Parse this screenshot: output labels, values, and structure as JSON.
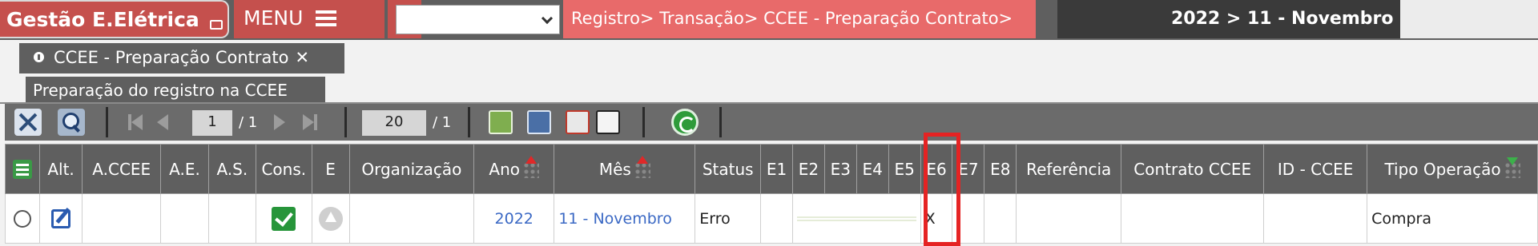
{
  "header": {
    "app_title": "Gestão E.Elétrica",
    "menu_label": "MENU",
    "select_value": "",
    "breadcrumb": "Registro> Transação> CCEE - Preparação Contrato>",
    "period": "2022 > 11 - Novembro"
  },
  "tabs": {
    "main_label": "CCEE - Preparação Contrato",
    "close_glyph": "✕",
    "sub_label": "Preparação do registro na CCEE"
  },
  "toolbar": {
    "page_current": "1",
    "page_total": "/ 1",
    "page_size": "20",
    "page_size_total": "/ 1"
  },
  "table": {
    "columns": [
      "Alt.",
      "A.CCEE",
      "A.E.",
      "A.S.",
      "Cons.",
      "E",
      "Organização",
      "Ano",
      "Mês",
      "Status",
      "E1",
      "E2",
      "E3",
      "E4",
      "E5",
      "E6",
      "E7",
      "E8",
      "Referência",
      "Contrato CCEE",
      "ID - CCEE",
      "Tipo Operação"
    ],
    "row": {
      "ano": "2022",
      "mes": "11 - Novembro",
      "status": "Erro",
      "e6": "X",
      "tipo_operacao": "Compra"
    }
  },
  "colors": {
    "brand_red": "#c5504d",
    "breadcrumb_red": "#e86a6a",
    "bar_gray": "#5f5f5f",
    "link_blue": "#3a68c4",
    "highlight_red": "#e52323"
  },
  "icons": {
    "logo": "window-icon",
    "menu": "hamburger-icon",
    "lock": "lock-icon",
    "tools": "tools-icon",
    "search": "search-icon",
    "refresh": "refresh-icon",
    "check": "check-icon"
  }
}
